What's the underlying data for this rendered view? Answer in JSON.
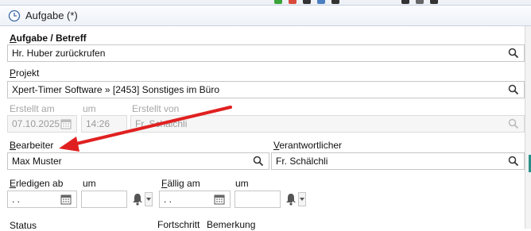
{
  "window": {
    "title": "Aufgabe (*)"
  },
  "colors": {
    "arrow": "#e02020",
    "accent": "#2a8f8a"
  },
  "task": {
    "label": "Aufgabe / Betreff",
    "value": "Hr. Huber zurückrufen"
  },
  "project": {
    "label": "Projekt",
    "value": "Xpert-Timer Software » [2453] Sonstiges im Büro"
  },
  "created": {
    "on_label": "Erstellt am",
    "on_value": "07.10.2025",
    "at_label": "um",
    "at_value": "14:26",
    "by_label": "Erstellt von",
    "by_value": "Fr. Schälchli"
  },
  "assignee": {
    "label": "Bearbeiter",
    "value": "Max Muster"
  },
  "responsible": {
    "label": "Verantwortlicher",
    "value": "Fr. Schälchli"
  },
  "complete_by": {
    "label": "Erledigen ab",
    "date_value": " .  .",
    "time_label": "um",
    "time_value": ""
  },
  "due": {
    "label": "Fällig am",
    "date_value": " .  .",
    "time_label": "um",
    "time_value": ""
  },
  "bottom": {
    "status_label": "Status",
    "progress_label": "Fortschritt",
    "remark_label": "Bemerkung"
  },
  "icons": [
    "clock-icon",
    "search-icon",
    "calendar-icon",
    "bell-icon",
    "dropdown-arrow-icon"
  ]
}
